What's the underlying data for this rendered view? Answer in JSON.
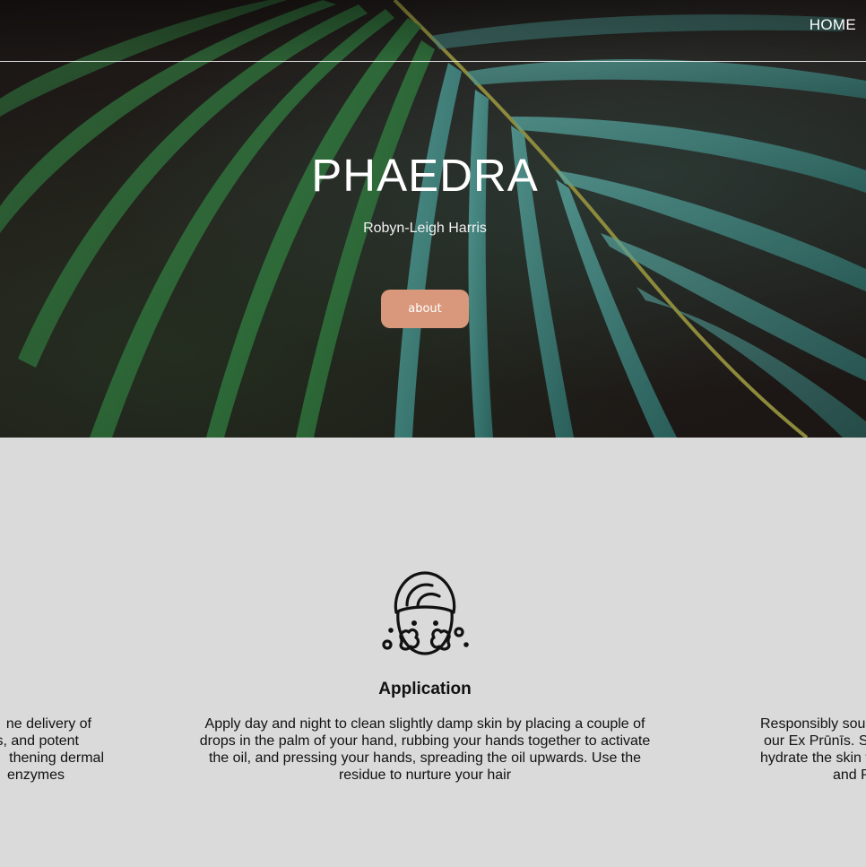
{
  "nav": {
    "home_label": "HOME"
  },
  "hero": {
    "title": "PHAEDRA",
    "subtitle": "Robyn-Leigh Harris",
    "button_label": "about"
  },
  "features": {
    "center": {
      "icon": "face-wash-icon",
      "title": "Application",
      "text": "Apply day and night to clean slightly damp skin by placing a couple of drops in the palm of your hand, rubbing your hands together to activate the oil, and pressing your hands, spreading the oil upwards. Use the residue to nurture your hair"
    },
    "left_partial": {
      "line1": "ne delivery of",
      "line2": "s, and potent",
      "line3": "thening dermal",
      "line4": "enzymes"
    },
    "right_partial": {
      "line1": "Responsibly sou",
      "line2": "our Ex Prūnīs. S",
      "line3": "hydrate the skin v",
      "line4": "and P"
    }
  },
  "colors": {
    "accent": "#d9987b",
    "section_bg": "#dadada",
    "hero_bg": "#1e1816"
  }
}
